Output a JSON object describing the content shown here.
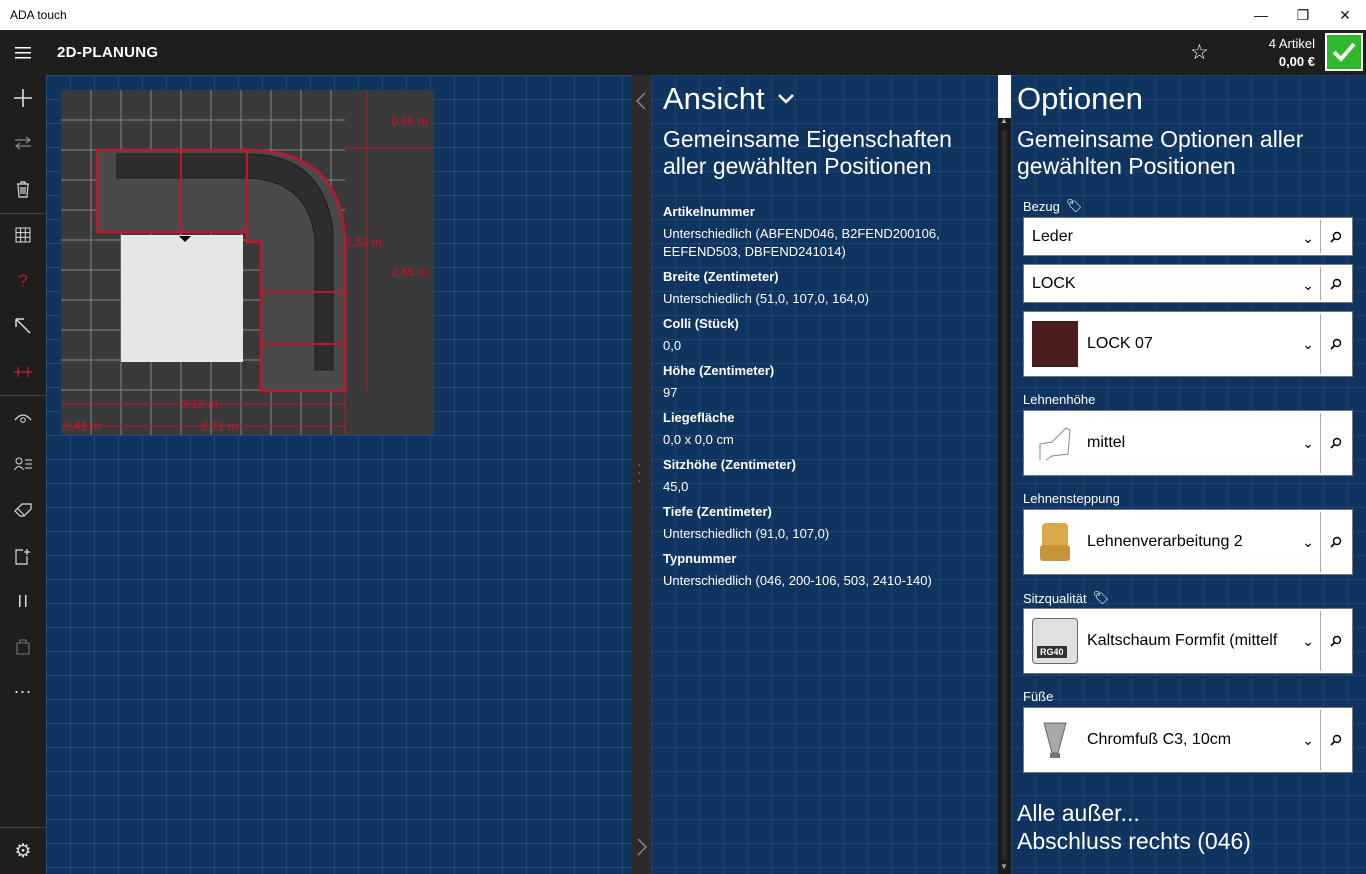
{
  "window": {
    "title": "ADA touch",
    "min": "—",
    "max": "❐",
    "close": "✕"
  },
  "header": {
    "title": "2D-PLANUNG",
    "cart_count": "4 Artikel",
    "cart_total": "0,00 €"
  },
  "plan": {
    "dims": {
      "top_right": "0,66 m",
      "right_a": "3,32 m",
      "right_b": "2,65 m",
      "bottom_a": "3,12 m",
      "bottom_left": "0,41 m",
      "bottom_b": "2,71 m"
    }
  },
  "ansicht": {
    "title": "Ansicht",
    "subtitle": "Gemeinsame Eigenschaften aller gewählten Positionen",
    "properties": [
      {
        "label": "Artikelnummer",
        "value": "Unterschiedlich (ABFEND046, B2FEND200106, EEFEND503, DBFEND241014)"
      },
      {
        "label": "Breite (Zentimeter)",
        "value": "Unterschiedlich (51,0, 107,0, 164,0)"
      },
      {
        "label": "Colli (Stück)",
        "value": "0,0"
      },
      {
        "label": "Höhe (Zentimeter)",
        "value": "97"
      },
      {
        "label": "Liegefläche",
        "value": "0,0 x 0,0 cm"
      },
      {
        "label": "Sitzhöhe (Zentimeter)",
        "value": "45,0"
      },
      {
        "label": "Tiefe (Zentimeter)",
        "value": "Unterschiedlich (91,0, 107,0)"
      },
      {
        "label": "Typnummer",
        "value": "Unterschiedlich (046, 200-106, 503, 2410-140)"
      }
    ]
  },
  "optionen": {
    "title": "Optionen",
    "subtitle": "Gemeinsame Optionen aller gewählten Positionen",
    "bezug_label": "Bezug",
    "bezug_material": "Leder",
    "bezug_collection": "LOCK",
    "bezug_color": "LOCK 07",
    "bezug_color_hex": "#4a1c1c",
    "lehnenhoehe_label": "Lehnenhöhe",
    "lehnenhoehe_value": "mittel",
    "lehnensteppung_label": "Lehnensteppung",
    "lehnensteppung_value": "Lehnenverarbeitung 2",
    "sitzqualitaet_label": "Sitzqualität",
    "sitzqualitaet_value": "Kaltschaum Formfit (mittelf",
    "sitzqualitaet_badge": "RG40",
    "fuesse_label": "Füße",
    "fuesse_value": "Chromfuß C3, 10cm",
    "alle_line1": "Alle außer...",
    "alle_line2": "Abschluss rechts (046)"
  },
  "colors": {
    "accent_green": "#2eb82e",
    "canvas_blue": "#0f3460",
    "highlight_red": "#c0182a"
  }
}
